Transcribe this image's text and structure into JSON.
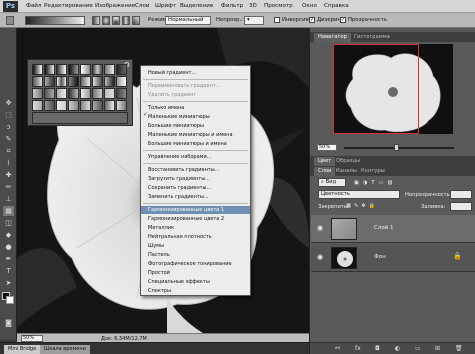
{
  "app": {
    "logo": "Ps"
  },
  "menubar": [
    "Файл",
    "Редактирование",
    "Изображение",
    "Слои",
    "Шрифт",
    "Выделение",
    "Фильтр",
    "3D",
    "Просмотр",
    "Окно",
    "Справка"
  ],
  "options": {
    "mode_label": "Режим:",
    "mode_value": "Нормальный",
    "opacity_label": "Непрозр.:",
    "invert_label": "Инверсия",
    "dither_label": "Дизеринг",
    "transparency_label": "Прозрачность",
    "dither_checked": true,
    "transparency_checked": true
  },
  "menu": {
    "items": [
      {
        "label": "Новый градиент...",
        "state": "normal"
      },
      {
        "label": "Переименовать градиент...",
        "state": "disabled"
      },
      {
        "label": "Удалить градиент",
        "state": "disabled"
      },
      {
        "label": "Только имена",
        "state": "normal"
      },
      {
        "label": "Маленькие миниатюры",
        "state": "checked"
      },
      {
        "label": "Большие миниатюры",
        "state": "normal"
      },
      {
        "label": "Маленькие миниатюры и имена",
        "state": "normal"
      },
      {
        "label": "Большие миниатюры и имена",
        "state": "normal"
      },
      {
        "label": "Управление наборами...",
        "state": "normal"
      },
      {
        "label": "Восстановить градиенты...",
        "state": "normal"
      },
      {
        "label": "Загрузить градиенты...",
        "state": "normal"
      },
      {
        "label": "Сохранить градиенты...",
        "state": "normal"
      },
      {
        "label": "Заменить градиенты...",
        "state": "normal"
      },
      {
        "label": "Гармонизированные цвета 1",
        "state": "highlighted"
      },
      {
        "label": "Гармонизированные цвета 2",
        "state": "normal"
      },
      {
        "label": "Металлик",
        "state": "normal"
      },
      {
        "label": "Нейтральная плотность",
        "state": "normal"
      },
      {
        "label": "Шумы",
        "state": "normal"
      },
      {
        "label": "Пастель",
        "state": "normal"
      },
      {
        "label": "Фотографическое тонирование",
        "state": "normal"
      },
      {
        "label": "Простой",
        "state": "normal"
      },
      {
        "label": "Специальные эффекты",
        "state": "normal"
      },
      {
        "label": "Спектры",
        "state": "normal"
      }
    ]
  },
  "status": {
    "zoom": "50%",
    "doc_info": "Док: 6,34M/12,7M"
  },
  "bottom_tabs": [
    "Mini Bridge",
    "Шкала времени"
  ],
  "navigator": {
    "tabs": [
      "Навигатор",
      "Гистограмма"
    ],
    "zoom": "50%"
  },
  "layers": {
    "tabs": [
      "Цвет",
      "Образцы"
    ],
    "subtabs": [
      "Слои",
      "Каналы",
      "Контуры"
    ],
    "kind": "Вид",
    "blend_mode": "Цветность",
    "opacity_label": "Непрозрачность:",
    "lock_label": "Закрепить:",
    "fill_label": "Заливка:",
    "list": [
      {
        "name": "Слой 1"
      },
      {
        "name": "Фон"
      }
    ]
  },
  "colors": {
    "accent": "#6f8fb3",
    "panel": "#5a5a5a"
  }
}
